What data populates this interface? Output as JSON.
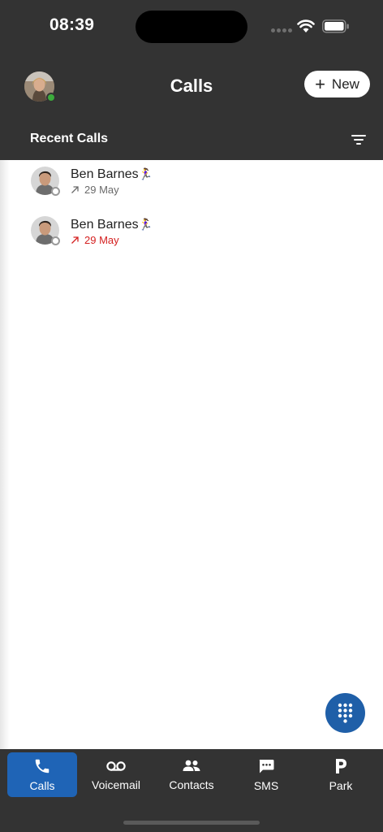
{
  "status_bar": {
    "time": "08:39"
  },
  "header": {
    "title": "Calls",
    "new_button_label": "New",
    "section_title": "Recent Calls"
  },
  "calls": [
    {
      "name": "Ben Barnes",
      "status_emoji": "🏃‍♀️",
      "date": "29 May",
      "direction": "outgoing",
      "missed": false
    },
    {
      "name": "Ben Barnes",
      "status_emoji": "🏃‍♀️",
      "date": "29 May",
      "direction": "outgoing",
      "missed": true
    }
  ],
  "tabs": [
    {
      "label": "Calls",
      "icon": "phone-icon",
      "active": true
    },
    {
      "label": "Voicemail",
      "icon": "voicemail-icon",
      "active": false
    },
    {
      "label": "Contacts",
      "icon": "contacts-icon",
      "active": false
    },
    {
      "label": "SMS",
      "icon": "sms-icon",
      "active": false
    },
    {
      "label": "Park",
      "icon": "park-icon",
      "active": false
    }
  ],
  "colors": {
    "header_background": "#333333",
    "accent_blue": "#1f64b6",
    "missed_red": "#d42020",
    "presence_online": "#3cab3c"
  }
}
